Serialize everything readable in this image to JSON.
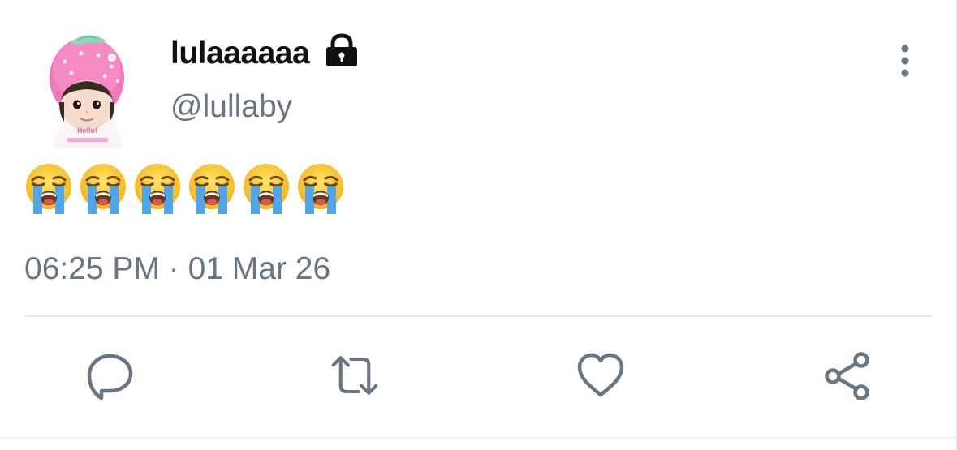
{
  "tweet": {
    "display_name": "lulaaaaaa",
    "handle": "@lullaby",
    "text": "😭😭😭😭😭😭",
    "emoji_count": 6,
    "timestamp": "06:25 PM · 01 Mar 26",
    "protected": true,
    "avatar_text": "Hello!"
  },
  "icons": {
    "lock": "lock-icon",
    "more": "more-vertical-icon",
    "reply": "reply-icon",
    "retweet": "retweet-icon",
    "like": "heart-icon",
    "share": "share-icon"
  },
  "colors": {
    "name": "#111111",
    "secondary": "#687684",
    "divider": "#e6e9ec",
    "icon": "#687684",
    "avatar_pink": "#f06fb3"
  }
}
